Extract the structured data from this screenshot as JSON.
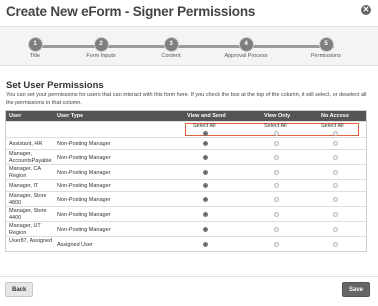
{
  "window": {
    "title": "Create New eForm - Signer Permissions"
  },
  "wizard": {
    "steps": [
      {
        "number": "1",
        "label": "Title"
      },
      {
        "number": "2",
        "label": "Form Inputs"
      },
      {
        "number": "3",
        "label": "Content"
      },
      {
        "number": "4",
        "label": "Approval Process"
      },
      {
        "number": "5",
        "label": "Permissions"
      }
    ]
  },
  "section": {
    "title": "Set User Permissions",
    "description": "You can set your permissions for users that can interact with this form here. If you check the box at the top of the column, it will select, or deselect all the permissions in that column."
  },
  "table": {
    "headers": {
      "user": "User",
      "user_type": "User Type",
      "view_send": "View and Send",
      "view_only": "View Only",
      "no_access": "No Access"
    },
    "select_all_label": "Select All",
    "select_all_selected": "view_send",
    "rows": [
      {
        "user": "Assistant, HR",
        "user_type": "Non-Posting Manager",
        "permission": "view_send"
      },
      {
        "user": "Manager, AccountsPayable",
        "user_type": "Non-Posting Manager",
        "permission": "view_send"
      },
      {
        "user": "Manager, CA Region",
        "user_type": "Non-Posting Manager",
        "permission": "view_send"
      },
      {
        "user": "Manager, IT",
        "user_type": "Non-Posting Manager",
        "permission": "view_send"
      },
      {
        "user": "Manager, Store 4800",
        "user_type": "Non-Posting Manager",
        "permission": "view_send"
      },
      {
        "user": "Manager, Store 4400",
        "user_type": "Non-Posting Manager",
        "permission": "view_send"
      },
      {
        "user": "Manager, UT Region",
        "user_type": "Non-Posting Manager",
        "permission": "view_send"
      },
      {
        "user": "User87, Assigned",
        "user_type": "Assigned User",
        "permission": "view_send"
      }
    ]
  },
  "footer": {
    "back_label": "Back",
    "save_label": "Save"
  }
}
